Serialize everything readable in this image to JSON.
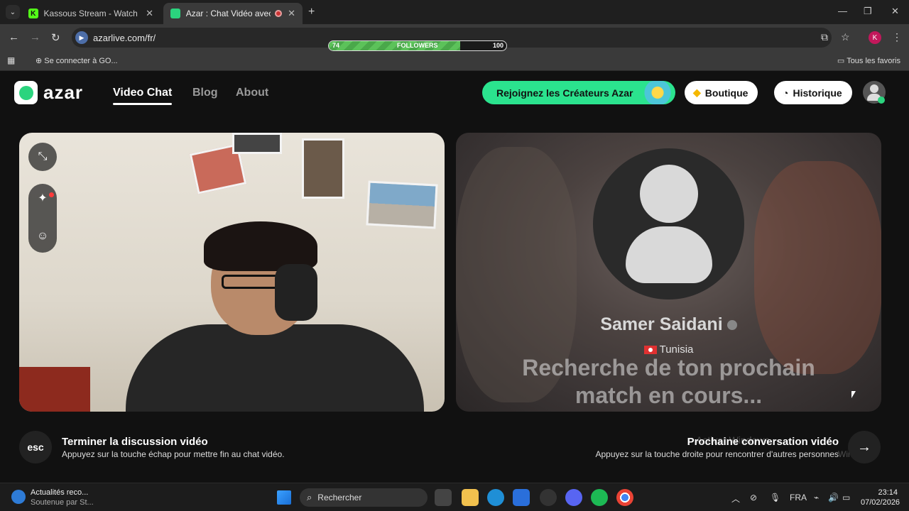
{
  "browser": {
    "tabs": [
      {
        "title": "Kassous Stream - Watch Live on",
        "favicon": "K",
        "close": "✕"
      },
      {
        "title": "Azar : Chat Vidéo avec de n",
        "close": "✕"
      }
    ],
    "new_tab": "+",
    "url": "azarlive.com/fr/",
    "profile_initial": "K",
    "followers": {
      "label": "FOLLOWERS",
      "current": "74",
      "goal": "100",
      "progress": 0.74
    },
    "bookmarks": {
      "item": "Se connecter à GO...",
      "all": "Tous les favoris"
    }
  },
  "site": {
    "logo_text": "azar",
    "nav": [
      {
        "label": "Video Chat",
        "active": true
      },
      {
        "label": "Blog",
        "active": false
      },
      {
        "label": "About",
        "active": false
      }
    ],
    "creators_button": "Rejoignez les Créateurs Azar",
    "shop_button": "Boutique",
    "history_button": "Historique"
  },
  "remote": {
    "name": "Samer Saidani",
    "country": "Tunisia",
    "searching_line1": "Recherche de ton prochain",
    "searching_line2": "match en cours..."
  },
  "controls": {
    "esc_key": "esc",
    "end_title": "Terminer la discussion vidéo",
    "end_sub": "Appuyez sur la touche échap pour mettre fin au chat vidéo.",
    "next_title": "Prochaine conversation vidéo",
    "next_sub": "Appuyez sur la touche droite pour rencontrer d'autres personnes",
    "next_arrow": "→"
  },
  "watermark": {
    "line1": "Activer Windows",
    "line2": "Windows."
  },
  "taskbar": {
    "news_title": "Actualités reco...",
    "news_sub": "Soutenue par St...",
    "search_placeholder": "Rechercher",
    "lang": "FRA",
    "time": "23:14",
    "date": "07/02/2026"
  },
  "colors": {
    "accent": "#2be38e",
    "tab_active": "#3a3a3a",
    "followers_fill": "#5cc25a"
  }
}
